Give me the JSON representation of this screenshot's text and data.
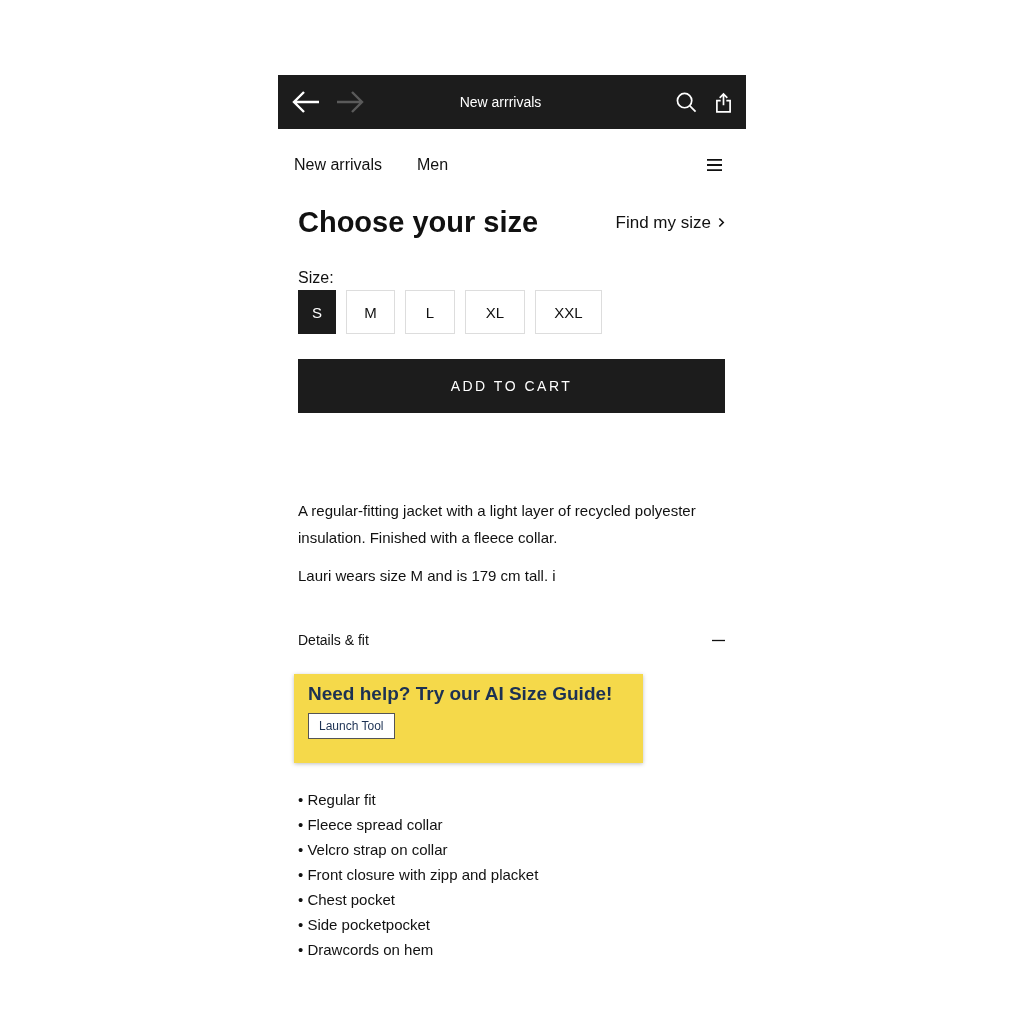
{
  "top_bar": {
    "title": "New arrrivals",
    "back_enabled": true,
    "forward_enabled": false
  },
  "breadcrumbs": [
    "New arrivals",
    "Men"
  ],
  "heading": "Choose your size",
  "find_size_link": "Find my size",
  "size_label": "Size:",
  "sizes": [
    {
      "label": "S",
      "selected": true
    },
    {
      "label": "M",
      "selected": false
    },
    {
      "label": "L",
      "selected": false
    },
    {
      "label": "XL",
      "selected": false
    },
    {
      "label": "XXL",
      "selected": false
    }
  ],
  "add_to_cart": "ADD TO CART",
  "description": [
    "A regular-fitting jacket with a light layer of recycled polyester insulation. Finished with a fleece collar.",
    "Lauri wears size M and is 179 cm tall. i"
  ],
  "details": {
    "title": "Details & fit",
    "expanded": true
  },
  "promo": {
    "title": "Need help? Try our AI Size Guide!",
    "button": "Launch Tool"
  },
  "features": [
    "• Regular fit",
    "• Fleece spread collar",
    "• Velcro strap on collar",
    "• Front closure with zipp and placket",
    "• Chest pocket",
    "• Side pocketpocket",
    "• Drawcords on hem"
  ]
}
